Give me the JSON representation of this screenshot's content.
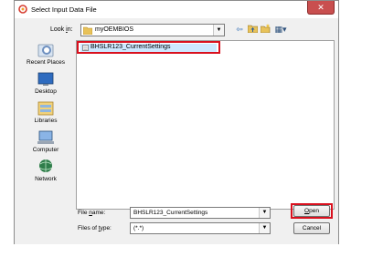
{
  "dialog": {
    "title": "Select Input Data File",
    "close_glyph": "✕"
  },
  "look_in": {
    "label_pre": "Look ",
    "label_key": "i",
    "label_post": "n:",
    "value": "myOEMBIOS",
    "icon": "folder-icon"
  },
  "toolbar": {
    "back_glyph": "⇦",
    "up_glyph": "⇧",
    "new_folder_glyph": "✱",
    "view_glyph": "▦▾"
  },
  "places": [
    {
      "label": "Recent Places",
      "icon": "recent-places-icon"
    },
    {
      "label": "Desktop",
      "icon": "desktop-icon"
    },
    {
      "label": "Libraries",
      "icon": "libraries-icon"
    },
    {
      "label": "Computer",
      "icon": "computer-icon"
    },
    {
      "label": "Network",
      "icon": "network-icon"
    }
  ],
  "files": [
    {
      "name": "BHSLR123_CurrentSettings",
      "icon": "file-icon",
      "selected": true
    }
  ],
  "file_name": {
    "label_pre": "File ",
    "label_key": "n",
    "label_post": "ame:",
    "value": "BHSLR123_CurrentSettings"
  },
  "file_type": {
    "label_pre": "Files of ",
    "label_key": "t",
    "label_post": "ype:",
    "value": "(*.*)"
  },
  "buttons": {
    "open_key": "O",
    "open_rest": "pen",
    "cancel": "Cancel"
  },
  "colors": {
    "highlight": "#d9101e",
    "selection": "#cde8ff",
    "close_button": "#c94f4f"
  }
}
